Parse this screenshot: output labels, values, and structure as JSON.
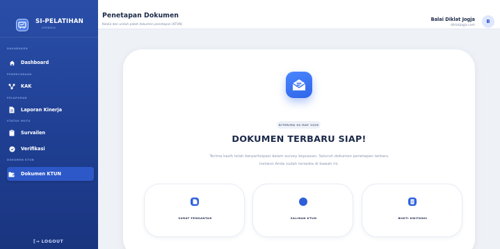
{
  "brand": {
    "title": "SI-PELATIHAN",
    "subtitle": "LEMBAGA"
  },
  "sidebar": {
    "sections": [
      {
        "label": "DASHBOARD",
        "items": [
          {
            "label": "Dashboard",
            "icon": "home-icon"
          }
        ]
      },
      {
        "label": "PERENCANAAN",
        "items": [
          {
            "label": "KAK",
            "icon": "network-icon"
          }
        ]
      },
      {
        "label": "PELAPORAN",
        "items": [
          {
            "label": "Laporan Kinerja",
            "icon": "document-icon"
          }
        ]
      },
      {
        "label": "STATUS MUTU",
        "items": [
          {
            "label": "Survailen",
            "icon": "clipboard-icon"
          },
          {
            "label": "Verifikasi",
            "icon": "badge-check-icon"
          }
        ]
      },
      {
        "label": "DOKUMEN KTUN",
        "items": [
          {
            "label": "Dokumen KTUN",
            "icon": "folder-edit-icon",
            "active": true
          }
        ]
      }
    ],
    "logout_label": "LOGOUT"
  },
  "header": {
    "title": "Penetapan Dokumen",
    "subtitle": "Kelola dan unduh paket dokumen penetapan (KTUN)",
    "user_name": "Balai Diklat Jogja",
    "user_email": "diklatjogja.com",
    "avatar_letter": "B"
  },
  "main": {
    "hero_icon": "envelope-open-icon",
    "badge": "DITERIMA 04 MAY 2026",
    "title": "DOKUMEN TERBARU SIAP!",
    "description": "Terima kasih telah berpartisipasi dalam survey kepuasan. Seluruh dokumen penetapan terbaru instansi Anda sudah tersedia di bawah ini.",
    "tiles": [
      {
        "label": "SURAT PENGANTAR",
        "icon": "file-icon"
      },
      {
        "label": "SALINAN KTUN",
        "icon": "circle-icon"
      },
      {
        "label": "BUKTI KWITANSI",
        "icon": "receipt-icon"
      }
    ]
  },
  "colors": {
    "sidebar_bg": "#1f3f93",
    "accent": "#2f62e0",
    "page_bg": "#eef1f6"
  }
}
